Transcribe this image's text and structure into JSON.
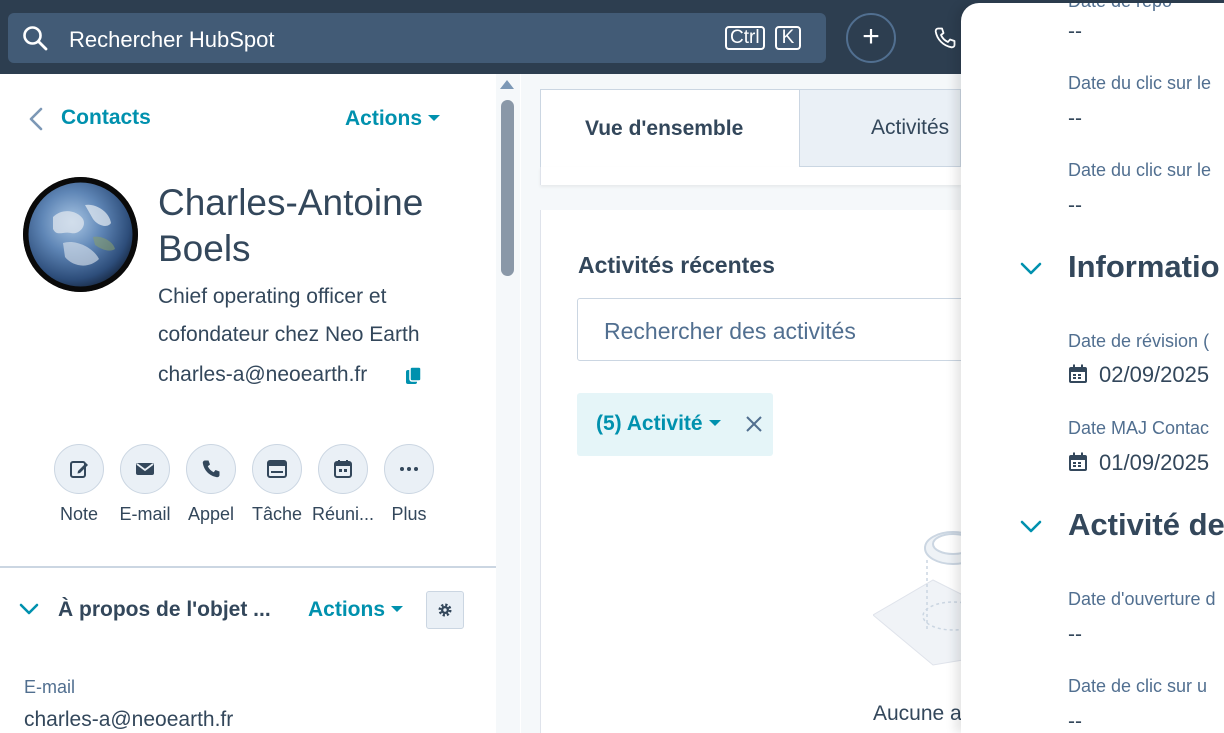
{
  "topbar": {
    "search_placeholder": "Rechercher HubSpot",
    "kbd_ctrl": "Ctrl",
    "kbd_k": "K",
    "plus_label": "+"
  },
  "left": {
    "back_label": "Contacts",
    "actions_label": "Actions",
    "name": "Charles-Antoine Boels",
    "job": "Chief operating officer et cofondateur chez Neo Earth",
    "email": "charles-a@neoearth.fr",
    "quick_actions": [
      {
        "label": "Note",
        "icon": "note-icon"
      },
      {
        "label": "E-mail",
        "icon": "email-icon"
      },
      {
        "label": "Appel",
        "icon": "phone-icon"
      },
      {
        "label": "Tâche",
        "icon": "task-icon"
      },
      {
        "label": "Réuni...",
        "icon": "meeting-icon"
      },
      {
        "label": "Plus",
        "icon": "more-icon"
      }
    ],
    "about_section": {
      "title": "À propos de l'objet ...",
      "actions_label": "Actions",
      "fields": [
        {
          "label": "E-mail",
          "value": "charles-a@neoearth.fr"
        }
      ]
    }
  },
  "middle": {
    "tabs": [
      {
        "label": "Vue d'ensemble",
        "active": true
      },
      {
        "label": "Activités",
        "active": false
      }
    ],
    "recent_activities_title": "Activités récentes",
    "activity_search_placeholder": "Rechercher des activités",
    "filter_chip": "(5) Activité",
    "empty_text": "Aucune a"
  },
  "right": {
    "top_cut_label": "Date de répo",
    "fields_top": [
      {
        "label": "",
        "value": "--"
      },
      {
        "label": "Date du clic sur le",
        "value": "--"
      },
      {
        "label": "Date du clic sur le",
        "value": "--"
      }
    ],
    "section_info": {
      "title": "Informatio",
      "fields": [
        {
          "label": "Date de révision (",
          "value": "02/09/2025"
        },
        {
          "label": "Date MAJ Contac",
          "value": "01/09/2025"
        }
      ]
    },
    "section_activity": {
      "title": "Activité de",
      "fields": [
        {
          "label": "Date d'ouverture d",
          "value": "--"
        },
        {
          "label": "Date de clic sur u",
          "value": "--"
        }
      ]
    }
  },
  "colors": {
    "topbar": "#2d3e50",
    "search": "#425b76",
    "accent": "#0091ae",
    "text": "#33475b"
  }
}
